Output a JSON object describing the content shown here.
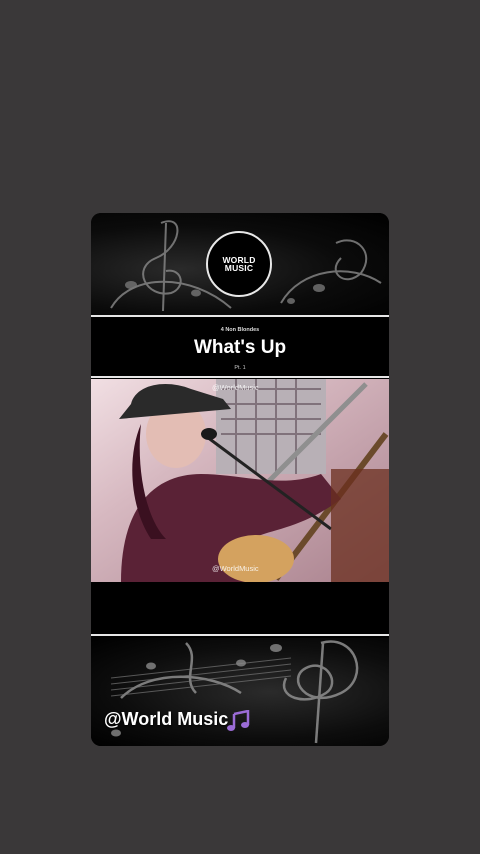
{
  "story": {
    "logo_text": "WORLD MUSIC",
    "artist": "4 Non Blondes",
    "song_title": "What's Up",
    "part": "Pt. 1",
    "video_watermark_top": "@WorldMusic",
    "video_watermark_bottom": "@WorldMusic",
    "handle": "@World Music",
    "handle_icon": "music-note-icon"
  },
  "colors": {
    "page_background": "#3a3839",
    "card_background": "#000000",
    "rule": "#e6e6e6",
    "note_accent": "#9b6cd6"
  }
}
